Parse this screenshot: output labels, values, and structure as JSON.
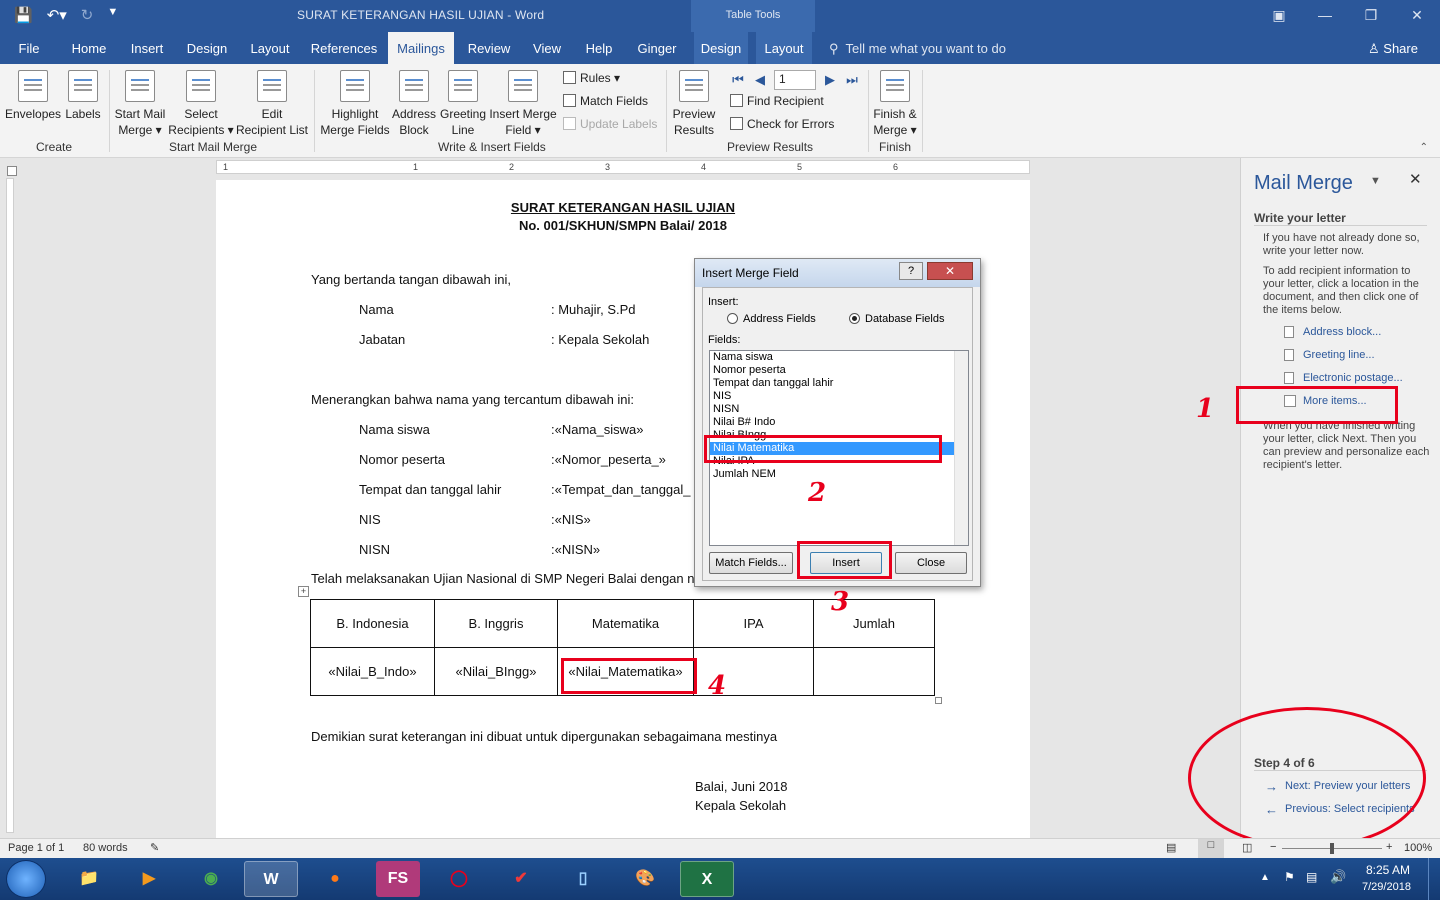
{
  "window": {
    "doc_title": "SURAT KETERANGAN HASIL UJIAN  -  Word",
    "context_tab_group": "Table Tools"
  },
  "tabs": [
    "File",
    "Home",
    "Insert",
    "Design",
    "Layout",
    "References",
    "Mailings",
    "Review",
    "View",
    "Help",
    "Ginger",
    "Design",
    "Layout"
  ],
  "active_tab": "Mailings",
  "tell_me": "Tell me what you want to do",
  "share": "Share",
  "ribbon": {
    "create": {
      "envelopes": "Envelopes",
      "labels": "Labels",
      "group": "Create"
    },
    "start": {
      "start_mail": "Start Mail",
      "merge": "Merge",
      "select": "Select",
      "recipients": "Recipients",
      "edit": "Edit",
      "recipient_list": "Recipient List",
      "group": "Start Mail Merge"
    },
    "write": {
      "highlight": "Highlight",
      "merge_fields": "Merge Fields",
      "address": "Address",
      "block": "Block",
      "greeting": "Greeting",
      "line": "Line",
      "insert_merge": "Insert Merge",
      "field": "Field",
      "rules": "Rules",
      "match_fields": "Match Fields",
      "update_labels": "Update Labels",
      "group": "Write & Insert Fields"
    },
    "preview": {
      "preview": "Preview",
      "results": "Results",
      "record": "1",
      "find_recipient": "Find Recipient",
      "check_errors": "Check for Errors",
      "group": "Preview Results"
    },
    "finish": {
      "finish": "Finish &",
      "merge": "Merge",
      "group": "Finish"
    }
  },
  "ruler": [
    "1",
    "1",
    "2",
    "3",
    "4",
    "5",
    "6"
  ],
  "document": {
    "title": "SURAT KETERANGAN HASIL UJIAN",
    "number": "No. 001/SKHUN/SMPN Balai/ 2018",
    "intro": "Yang bertanda tangan dibawah ini,",
    "signer": [
      {
        "label": "Nama",
        "value": ": Muhajir, S.Pd"
      },
      {
        "label": "Jabatan",
        "value": ": Kepala Sekolah"
      }
    ],
    "states": "Menerangkan bahwa nama yang tercantum dibawah ini:",
    "student": [
      {
        "label": "Nama siswa",
        "value": ":«Nama_siswa»"
      },
      {
        "label": "Nomor peserta",
        "value": ":«Nomor_peserta_»"
      },
      {
        "label": "Tempat dan tanggal lahir",
        "value": ":«Tempat_dan_tanggal_"
      },
      {
        "label": "NIS",
        "value": ":«NIS»"
      },
      {
        "label": "NISN",
        "value": ":«NISN»"
      }
    ],
    "passed": "Telah melaksanakan Ujian Nasional di SMP Negeri Balai dengan n",
    "table_headers": [
      "B. Indonesia",
      "B. Inggris",
      "Matematika",
      "IPA",
      "Jumlah"
    ],
    "table_values": [
      "«Nilai_B_Indo»",
      "«Nilai_BIngg»",
      "«Nilai_Matematika»",
      "",
      ""
    ],
    "closing": "Demikian surat keterangan ini dibuat untuk dipergunakan sebagaimana mestinya",
    "place_date": "Balai, Juni 2018",
    "sign_title": "Kepala Sekolah"
  },
  "dialog": {
    "title": "Insert Merge Field",
    "help": "?",
    "insert_label": "Insert:",
    "address_fields": "Address Fields",
    "database_fields": "Database Fields",
    "fields_label": "Fields:",
    "fields": [
      "Nama siswa",
      "Nomor peserta",
      "Tempat dan tanggal lahir",
      "NIS",
      "NISN",
      "Nilai B# Indo",
      "Nilai BIngg",
      "Nilai Matematika",
      "Nilai IPA",
      "Jumlah NEM"
    ],
    "selected_field": "Nilai Matematika",
    "match_fields": "Match Fields...",
    "insert": "Insert",
    "close": "Close"
  },
  "pane": {
    "title": "Mail Merge",
    "heading": "Write your letter",
    "p1": "If you have not already done so, write your letter now.",
    "p2": "To add recipient information to your letter, click a location in the document, and then click one of the items below.",
    "links": [
      "Address block...",
      "Greeting line...",
      "Electronic postage...",
      "More items..."
    ],
    "p3": "When you have finished writing your letter, click Next. Then you can preview and personalize each recipient's letter.",
    "step": "Step 4 of 6",
    "next": "Next: Preview your letters",
    "previous": "Previous: Select recipients"
  },
  "annotations": [
    "1",
    "2",
    "3",
    "4"
  ],
  "annotation_color": "#e8001c",
  "status": {
    "page": "Page 1 of 1",
    "words": "80 words",
    "zoom": "100%"
  },
  "taskbar": {
    "time": "8:25 AM",
    "date": "7/29/2018",
    "apps": [
      "explorer-icon",
      "media-player-icon",
      "chrome-icon",
      "word-icon",
      "firefox-icon",
      "faststone-icon",
      "opera-icon",
      "vivaldi-icon",
      "notepad-icon",
      "paint-icon",
      "excel-icon"
    ],
    "fs_label": "FS"
  },
  "colors": {
    "word_blue": "#2b579a",
    "selection": "#3399ff"
  }
}
